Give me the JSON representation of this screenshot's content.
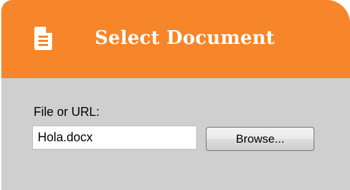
{
  "dialog": {
    "title": "Select Document",
    "header_icon": "document-icon",
    "colors": {
      "header": "#f68629",
      "panel": "#cfcfcf",
      "title_text": "#ffffff"
    }
  },
  "file_field": {
    "label": "File or URL:",
    "value": "Hola.docx"
  },
  "browse_button": {
    "label": "Browse..."
  }
}
